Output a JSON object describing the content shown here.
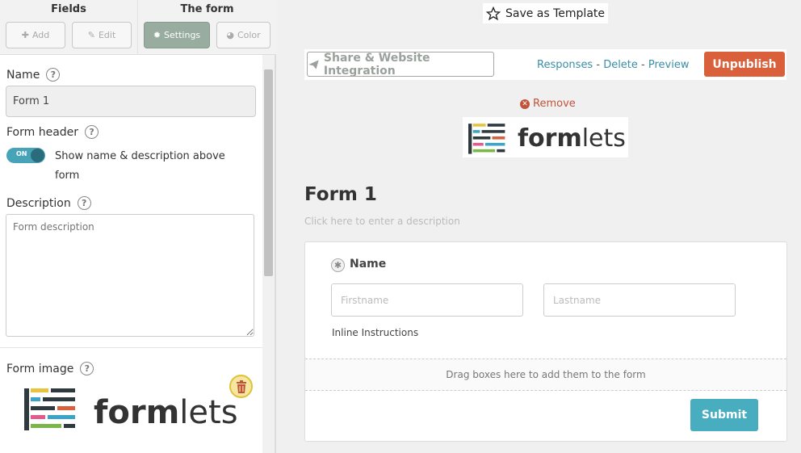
{
  "left_panel": {
    "tabs": {
      "fields": "Fields",
      "form": "The form"
    },
    "buttons": {
      "add": "Add",
      "edit": "Edit",
      "settings": "Settings",
      "color": "Color"
    },
    "name_label": "Name",
    "name_value": "Form 1",
    "form_header_label": "Form header",
    "toggle_state": "ON",
    "toggle_text": "Show name & description above form",
    "description_label": "Description",
    "description_placeholder": "Form description",
    "form_image_label": "Form image",
    "logo_text": {
      "bold": "form",
      "light": "lets"
    }
  },
  "toolbar": {
    "save_template": "Save as Template",
    "share": "Share & Website Integration",
    "responses": "Responses",
    "delete": "Delete",
    "preview": "Preview",
    "link_sep": " - ",
    "unpublish": "Unpublish"
  },
  "form": {
    "remove": "Remove",
    "logo_text": {
      "bold": "form",
      "light": "lets"
    },
    "title": "Form 1",
    "description_prompt": "Click here to enter a description",
    "field_label": "Name",
    "firstname_placeholder": "Firstname",
    "lastname_placeholder": "Lastname",
    "inline_instructions": "Inline Instructions",
    "dropzone": "Drag boxes here to add them to the form",
    "submit": "Submit"
  },
  "colors": {
    "accent": "#47a3b8",
    "unpublish": "#d9603b",
    "settings_active": "#98ac9f",
    "link": "#3b8ea5"
  },
  "icons": [
    "plus-icon",
    "pencil-icon",
    "gear-icon",
    "palette-icon",
    "help-icon",
    "trash-icon",
    "star-icon",
    "paper-plane-icon",
    "remove-icon",
    "asterisk-icon"
  ]
}
